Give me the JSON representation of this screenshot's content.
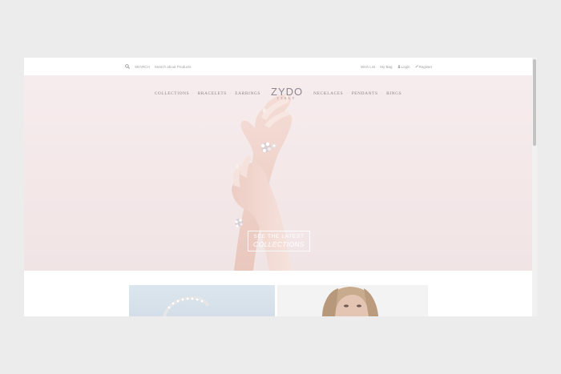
{
  "topbar": {
    "search_label": "SEARCH",
    "search_placeholder": "Search about Products",
    "links": {
      "wishlist": "Wish List",
      "my_bag": "My Bag",
      "login": "Login",
      "register": "Register"
    }
  },
  "nav": {
    "left": [
      "COLLECTIONS",
      "BRACELETS",
      "EARRINGS"
    ],
    "right": [
      "NECKLACES",
      "PENDANTS",
      "RINGS"
    ],
    "logo_brand": "ZYDO",
    "logo_sub": "ITALY"
  },
  "hero": {
    "cta_line1": "SEE THE LATEST",
    "cta_line2": "COLLECTIONS"
  },
  "colors": {
    "hero_bg": "#f3e7e8",
    "nav_text": "#8a8088",
    "page_bg": "#ececec"
  }
}
